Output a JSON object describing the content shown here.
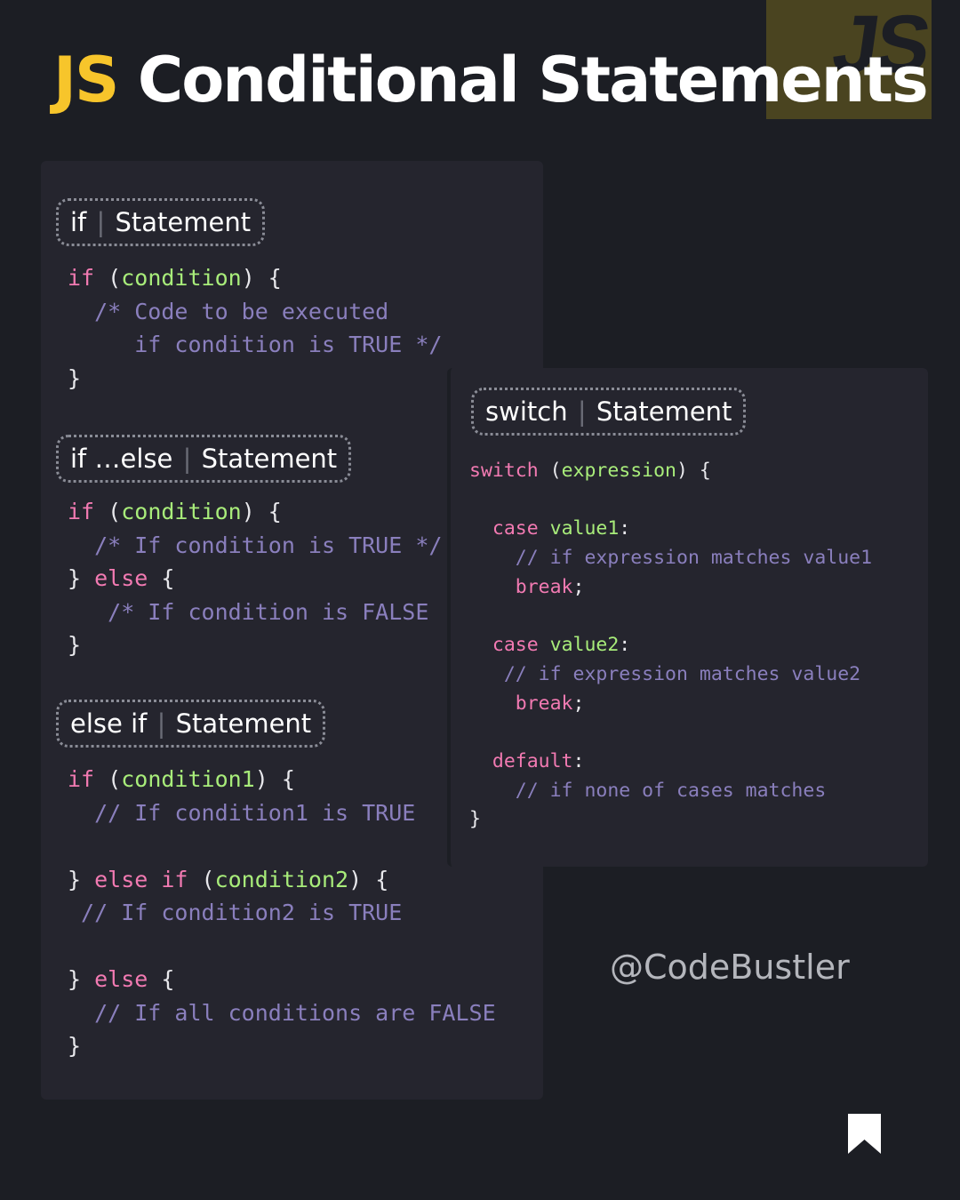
{
  "logo_text": "JS",
  "title": {
    "accent": "JS",
    "rest": "Conditional Statements"
  },
  "sections": {
    "if": {
      "label_kw": "if",
      "label_sep": "|",
      "label_word": "Statement",
      "code": [
        [
          "if",
          " (",
          "condition",
          ") {"
        ],
        [
          "  /* Code to be executed"
        ],
        [
          "     if condition is TRUE */"
        ],
        [
          "}"
        ]
      ]
    },
    "if_else": {
      "label_kw": "if …else",
      "label_sep": "|",
      "label_word": "Statement",
      "code": [
        [
          "if",
          " (",
          "condition",
          ") {"
        ],
        [
          "  /* If condition is TRUE */"
        ],
        [
          "} ",
          "else",
          " {"
        ],
        [
          "   /* If condition is FALSE"
        ],
        [
          "}"
        ]
      ]
    },
    "else_if": {
      "label_kw": "else if",
      "label_sep": "|",
      "label_word": "Statement",
      "code": [
        [
          "if",
          " (",
          "condition1",
          ") {"
        ],
        [
          "  // If condition1 is TRUE"
        ],
        [
          ""
        ],
        [
          "} ",
          "else if",
          " (",
          "condition2",
          ") {"
        ],
        [
          " // If condition2 is TRUE"
        ],
        [
          ""
        ],
        [
          "} ",
          "else",
          " {"
        ],
        [
          "  // If all conditions are FALSE"
        ],
        [
          "}"
        ]
      ]
    },
    "switch": {
      "label_kw": "switch",
      "label_sep": "|",
      "label_word": "Statement",
      "code": [
        [
          "switch",
          " (",
          "expression",
          ") {"
        ],
        [
          ""
        ],
        [
          "  ",
          "case",
          " ",
          "value1",
          ":"
        ],
        [
          "    // if expression matches value1"
        ],
        [
          "    ",
          "break",
          ";"
        ],
        [
          ""
        ],
        [
          "  ",
          "case",
          " ",
          "value2",
          ":"
        ],
        [
          "   // if expression matches value2"
        ],
        [
          "    ",
          "break",
          ";"
        ],
        [
          ""
        ],
        [
          "  ",
          "default",
          ":"
        ],
        [
          "    // if none of cases matches"
        ],
        [
          "}"
        ]
      ]
    }
  },
  "handle": "@CodeBustler",
  "icons": {
    "brand_logo": "js-logo",
    "bookmark": "bookmark-icon"
  },
  "colors": {
    "background": "#1c1e24",
    "panel": "#25252e",
    "accent_yellow": "#f7c52b",
    "keyword": "#f27ab2",
    "condition": "#a8ec7a",
    "comment": "#8a7fbd"
  }
}
